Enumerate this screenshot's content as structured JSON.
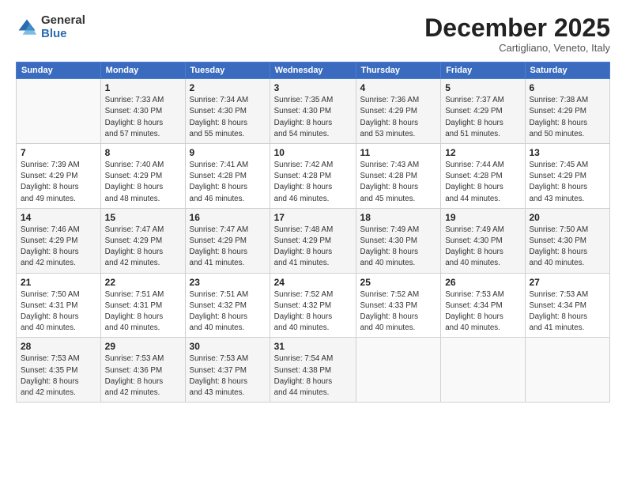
{
  "logo": {
    "general": "General",
    "blue": "Blue"
  },
  "title": "December 2025",
  "subtitle": "Cartigliano, Veneto, Italy",
  "days_header": [
    "Sunday",
    "Monday",
    "Tuesday",
    "Wednesday",
    "Thursday",
    "Friday",
    "Saturday"
  ],
  "weeks": [
    [
      {
        "day": "",
        "info": ""
      },
      {
        "day": "1",
        "info": "Sunrise: 7:33 AM\nSunset: 4:30 PM\nDaylight: 8 hours\nand 57 minutes."
      },
      {
        "day": "2",
        "info": "Sunrise: 7:34 AM\nSunset: 4:30 PM\nDaylight: 8 hours\nand 55 minutes."
      },
      {
        "day": "3",
        "info": "Sunrise: 7:35 AM\nSunset: 4:30 PM\nDaylight: 8 hours\nand 54 minutes."
      },
      {
        "day": "4",
        "info": "Sunrise: 7:36 AM\nSunset: 4:29 PM\nDaylight: 8 hours\nand 53 minutes."
      },
      {
        "day": "5",
        "info": "Sunrise: 7:37 AM\nSunset: 4:29 PM\nDaylight: 8 hours\nand 51 minutes."
      },
      {
        "day": "6",
        "info": "Sunrise: 7:38 AM\nSunset: 4:29 PM\nDaylight: 8 hours\nand 50 minutes."
      }
    ],
    [
      {
        "day": "7",
        "info": "Sunrise: 7:39 AM\nSunset: 4:29 PM\nDaylight: 8 hours\nand 49 minutes."
      },
      {
        "day": "8",
        "info": "Sunrise: 7:40 AM\nSunset: 4:29 PM\nDaylight: 8 hours\nand 48 minutes."
      },
      {
        "day": "9",
        "info": "Sunrise: 7:41 AM\nSunset: 4:28 PM\nDaylight: 8 hours\nand 46 minutes."
      },
      {
        "day": "10",
        "info": "Sunrise: 7:42 AM\nSunset: 4:28 PM\nDaylight: 8 hours\nand 46 minutes."
      },
      {
        "day": "11",
        "info": "Sunrise: 7:43 AM\nSunset: 4:28 PM\nDaylight: 8 hours\nand 45 minutes."
      },
      {
        "day": "12",
        "info": "Sunrise: 7:44 AM\nSunset: 4:28 PM\nDaylight: 8 hours\nand 44 minutes."
      },
      {
        "day": "13",
        "info": "Sunrise: 7:45 AM\nSunset: 4:29 PM\nDaylight: 8 hours\nand 43 minutes."
      }
    ],
    [
      {
        "day": "14",
        "info": "Sunrise: 7:46 AM\nSunset: 4:29 PM\nDaylight: 8 hours\nand 42 minutes."
      },
      {
        "day": "15",
        "info": "Sunrise: 7:47 AM\nSunset: 4:29 PM\nDaylight: 8 hours\nand 42 minutes."
      },
      {
        "day": "16",
        "info": "Sunrise: 7:47 AM\nSunset: 4:29 PM\nDaylight: 8 hours\nand 41 minutes."
      },
      {
        "day": "17",
        "info": "Sunrise: 7:48 AM\nSunset: 4:29 PM\nDaylight: 8 hours\nand 41 minutes."
      },
      {
        "day": "18",
        "info": "Sunrise: 7:49 AM\nSunset: 4:30 PM\nDaylight: 8 hours\nand 40 minutes."
      },
      {
        "day": "19",
        "info": "Sunrise: 7:49 AM\nSunset: 4:30 PM\nDaylight: 8 hours\nand 40 minutes."
      },
      {
        "day": "20",
        "info": "Sunrise: 7:50 AM\nSunset: 4:30 PM\nDaylight: 8 hours\nand 40 minutes."
      }
    ],
    [
      {
        "day": "21",
        "info": "Sunrise: 7:50 AM\nSunset: 4:31 PM\nDaylight: 8 hours\nand 40 minutes."
      },
      {
        "day": "22",
        "info": "Sunrise: 7:51 AM\nSunset: 4:31 PM\nDaylight: 8 hours\nand 40 minutes."
      },
      {
        "day": "23",
        "info": "Sunrise: 7:51 AM\nSunset: 4:32 PM\nDaylight: 8 hours\nand 40 minutes."
      },
      {
        "day": "24",
        "info": "Sunrise: 7:52 AM\nSunset: 4:32 PM\nDaylight: 8 hours\nand 40 minutes."
      },
      {
        "day": "25",
        "info": "Sunrise: 7:52 AM\nSunset: 4:33 PM\nDaylight: 8 hours\nand 40 minutes."
      },
      {
        "day": "26",
        "info": "Sunrise: 7:53 AM\nSunset: 4:34 PM\nDaylight: 8 hours\nand 40 minutes."
      },
      {
        "day": "27",
        "info": "Sunrise: 7:53 AM\nSunset: 4:34 PM\nDaylight: 8 hours\nand 41 minutes."
      }
    ],
    [
      {
        "day": "28",
        "info": "Sunrise: 7:53 AM\nSunset: 4:35 PM\nDaylight: 8 hours\nand 42 minutes."
      },
      {
        "day": "29",
        "info": "Sunrise: 7:53 AM\nSunset: 4:36 PM\nDaylight: 8 hours\nand 42 minutes."
      },
      {
        "day": "30",
        "info": "Sunrise: 7:53 AM\nSunset: 4:37 PM\nDaylight: 8 hours\nand 43 minutes."
      },
      {
        "day": "31",
        "info": "Sunrise: 7:54 AM\nSunset: 4:38 PM\nDaylight: 8 hours\nand 44 minutes."
      },
      {
        "day": "",
        "info": ""
      },
      {
        "day": "",
        "info": ""
      },
      {
        "day": "",
        "info": ""
      }
    ]
  ]
}
